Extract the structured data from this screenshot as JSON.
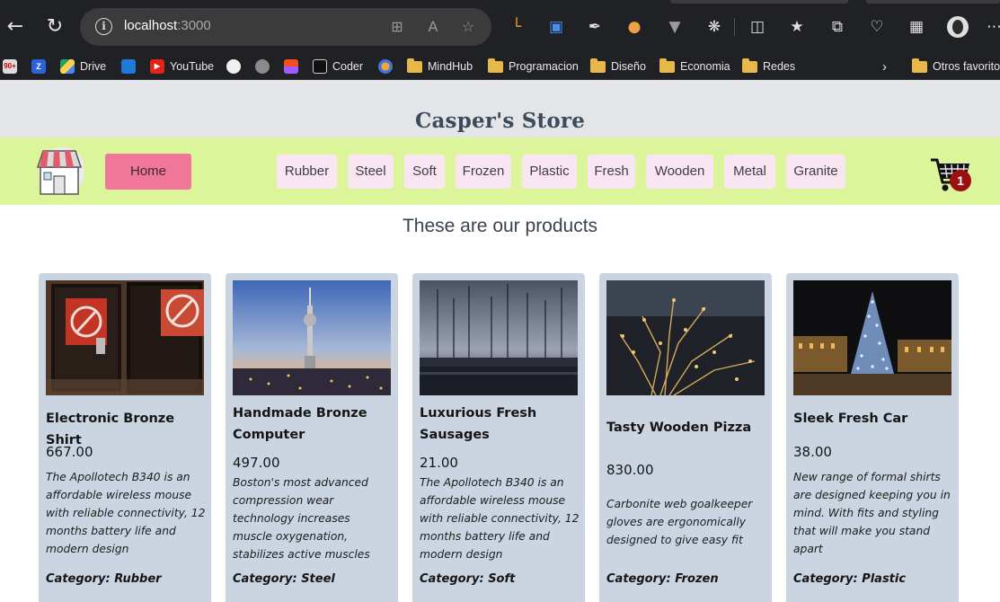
{
  "browser": {
    "url_host": "localhost",
    "url_port": ":3000",
    "bookmarks": [
      {
        "label": ""
      },
      {
        "label": ""
      },
      {
        "label": "Drive"
      },
      {
        "label": ""
      },
      {
        "label": "YouTube"
      },
      {
        "label": ""
      },
      {
        "label": ""
      },
      {
        "label": ""
      },
      {
        "label": "Coder"
      },
      {
        "label": ""
      },
      {
        "label": "MindHub"
      },
      {
        "label": "Programacion"
      },
      {
        "label": "Diseño"
      },
      {
        "label": "Economia"
      },
      {
        "label": "Redes"
      },
      {
        "label": "Otros favoritos"
      }
    ],
    "badge_90": "90+",
    "badge_z": "Z"
  },
  "store": {
    "title": "Casper's Store",
    "home_label": "Home",
    "categories": [
      "Rubber",
      "Steel",
      "Soft",
      "Frozen",
      "Plastic",
      "Fresh",
      "Wooden",
      "Metal",
      "Granite"
    ],
    "cart_count": "1",
    "section_heading": "These are our products"
  },
  "products": [
    {
      "name": "Electronic Bronze Shirt",
      "price": "667.00",
      "description": "The Apollotech B340 is an affordable wireless mouse with reliable connectivity, 12 months battery life and modern design",
      "category": "Category: Rubber"
    },
    {
      "name": "Handmade Bronze Computer",
      "price": "497.00",
      "description": "Boston's most advanced compression wear technology increases muscle oxygenation, stabilizes active muscles",
      "category": "Category: Steel"
    },
    {
      "name": "Luxurious Fresh Sausages",
      "price": "21.00",
      "description": "The Apollotech B340 is an affordable wireless mouse with reliable connectivity, 12 months battery life and modern design",
      "category": "Category: Soft"
    },
    {
      "name": "Tasty Wooden Pizza",
      "price": "830.00",
      "description": "Carbonite web goalkeeper gloves are ergonomically designed to give easy fit",
      "category": "Category: Frozen"
    },
    {
      "name": "Sleek Fresh Car",
      "price": "38.00",
      "description": "New range of formal shirts are designed keeping you in mind. With fits and styling that will make you stand apart",
      "category": "Category: Plastic"
    }
  ]
}
